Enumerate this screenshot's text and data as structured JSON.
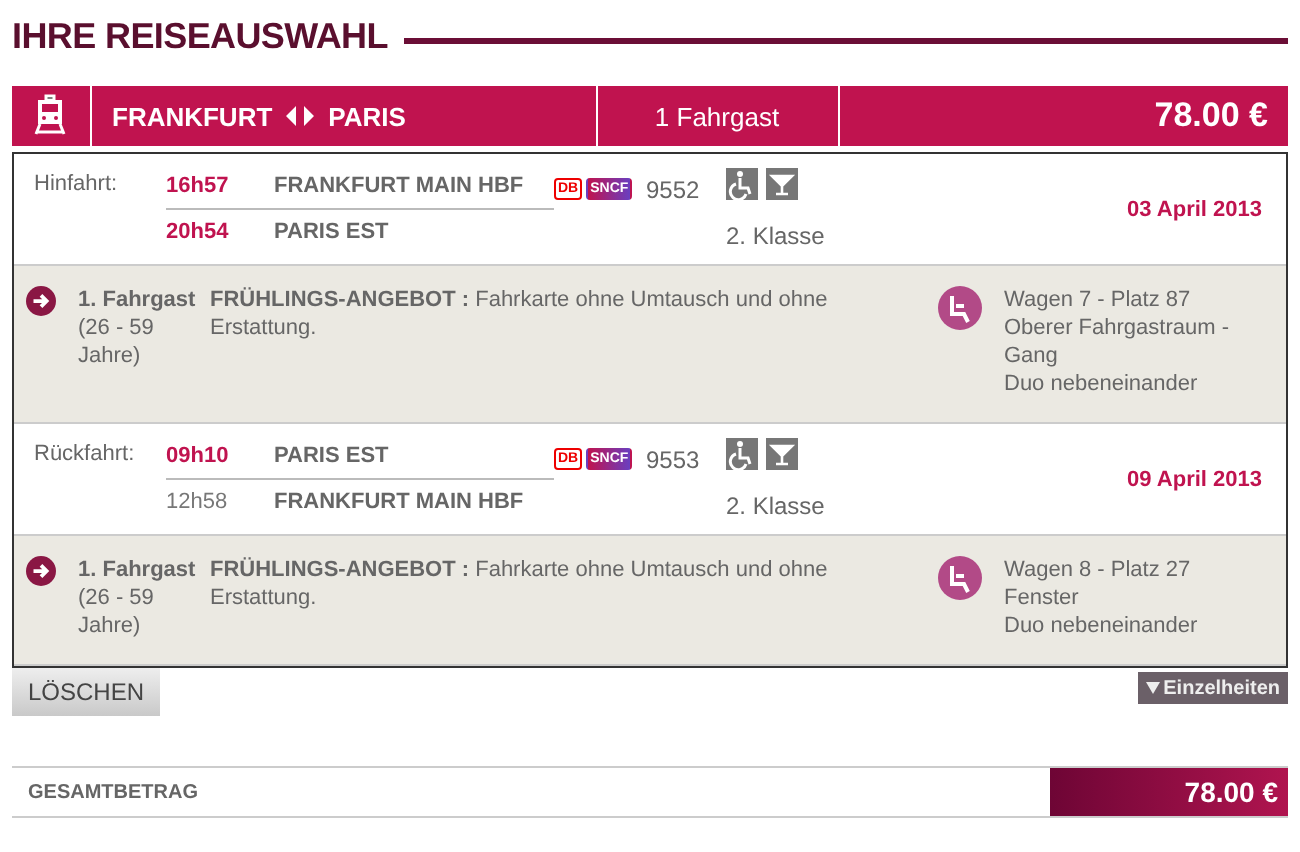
{
  "title": "IHRE REISEAUSWAHL",
  "summary": {
    "from": "FRANKFURT",
    "to": "PARIS",
    "passengers": "1 Fahrgast",
    "price": "78.00 €"
  },
  "journeys": [
    {
      "label": "Hinfahrt:",
      "stops": [
        {
          "time": "16h57",
          "station": "FRANKFURT MAIN HBF",
          "highlighted": true
        },
        {
          "time": "20h54",
          "station": "PARIS EST",
          "highlighted": true
        }
      ],
      "operators": [
        "DB",
        "SNCF"
      ],
      "train": "9552",
      "travel_class": "2. Klasse",
      "date": "03 April 2013",
      "passenger": {
        "name": "1. Fahrgast",
        "age": "(26 - 59 Jahre)",
        "offer": "**FRÜHLINGS-ANGEBOT :** Fahrkarte ohne Umtausch und ohne Erstattung.",
        "seat": [
          "Wagen 7 - Platz 87",
          "Oberer Fahrgastraum - Gang",
          "Duo nebeneinander"
        ]
      }
    },
    {
      "label": "Rückfahrt:",
      "stops": [
        {
          "time": "09h10",
          "station": "PARIS EST",
          "highlighted": true
        },
        {
          "time": "12h58",
          "station": "FRANKFURT MAIN HBF",
          "highlighted": false
        }
      ],
      "operators": [
        "DB",
        "SNCF"
      ],
      "train": "9553",
      "travel_class": "2. Klasse",
      "date": "09 April 2013",
      "passenger": {
        "name": "1. Fahrgast",
        "age": "(26 - 59 Jahre)",
        "offer": "**FRÜHLINGS-ANGEBOT :** Fahrkarte ohne Umtausch und ohne Erstattung.",
        "seat": [
          "Wagen 8 - Platz 27",
          "Fenster",
          "Duo nebeneinander"
        ]
      }
    }
  ],
  "delete_button": "LÖSCHEN",
  "details_button": "Einzelheiten",
  "total": {
    "label": "GESAMTBETRAG",
    "amount": "78.00 €"
  }
}
